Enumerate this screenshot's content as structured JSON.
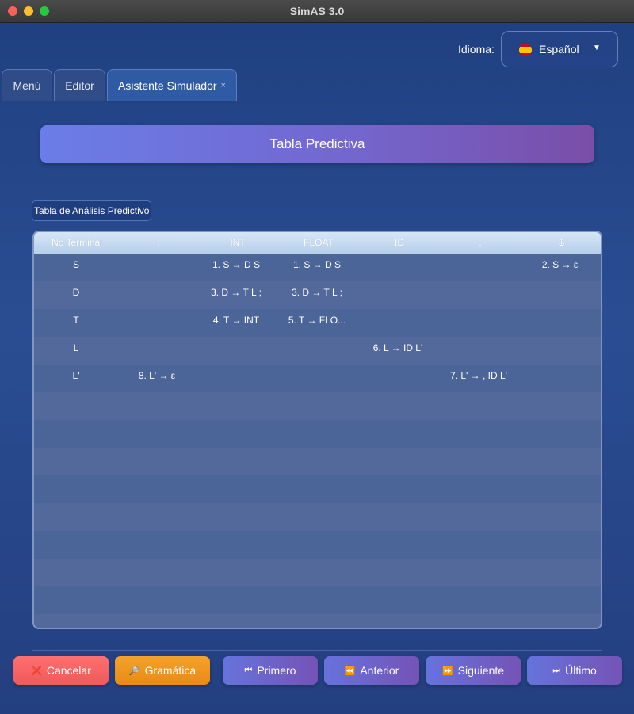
{
  "window": {
    "title": "SimAS 3.0"
  },
  "language": {
    "label": "Idioma:",
    "value": "Español"
  },
  "tabs": [
    {
      "label": "Menú"
    },
    {
      "label": "Editor"
    },
    {
      "label": "Asistente Simulador",
      "close": "×"
    }
  ],
  "banner": {
    "title": "Tabla Predictiva"
  },
  "section": {
    "label": "Tabla de Análisis Predictivo"
  },
  "table": {
    "headers": [
      "No Terminal",
      ";",
      "INT",
      "FLOAT",
      "ID",
      ",",
      "$"
    ],
    "rows": [
      {
        "nt": "S",
        "cells": [
          "",
          "1. S → D S",
          "1. S → D S",
          "",
          "",
          "2. S → ε"
        ]
      },
      {
        "nt": "D",
        "cells": [
          "",
          "3. D → T L ;",
          "3. D → T L ;",
          "",
          "",
          ""
        ]
      },
      {
        "nt": "T",
        "cells": [
          "",
          "4. T → INT",
          "5. T → FLO...",
          "",
          "",
          ""
        ]
      },
      {
        "nt": "L",
        "cells": [
          "",
          "",
          "",
          "6. L → ID L'",
          "",
          ""
        ]
      },
      {
        "nt": "L'",
        "cells": [
          "8. L' → ε",
          "",
          "",
          "",
          "7. L' → , ID L'",
          ""
        ]
      }
    ]
  },
  "buttons": {
    "cancel": "Cancelar",
    "grammar": "Gramática",
    "first": "Primero",
    "previous": "Anterior",
    "next": "Siguiente",
    "last": "Último"
  },
  "colors": {
    "background": "#2a4d92",
    "banner_start": "#6b7de8",
    "banner_end": "#7a4ea8",
    "cancel": "#ef5a5a",
    "grammar": "#e98a16"
  }
}
